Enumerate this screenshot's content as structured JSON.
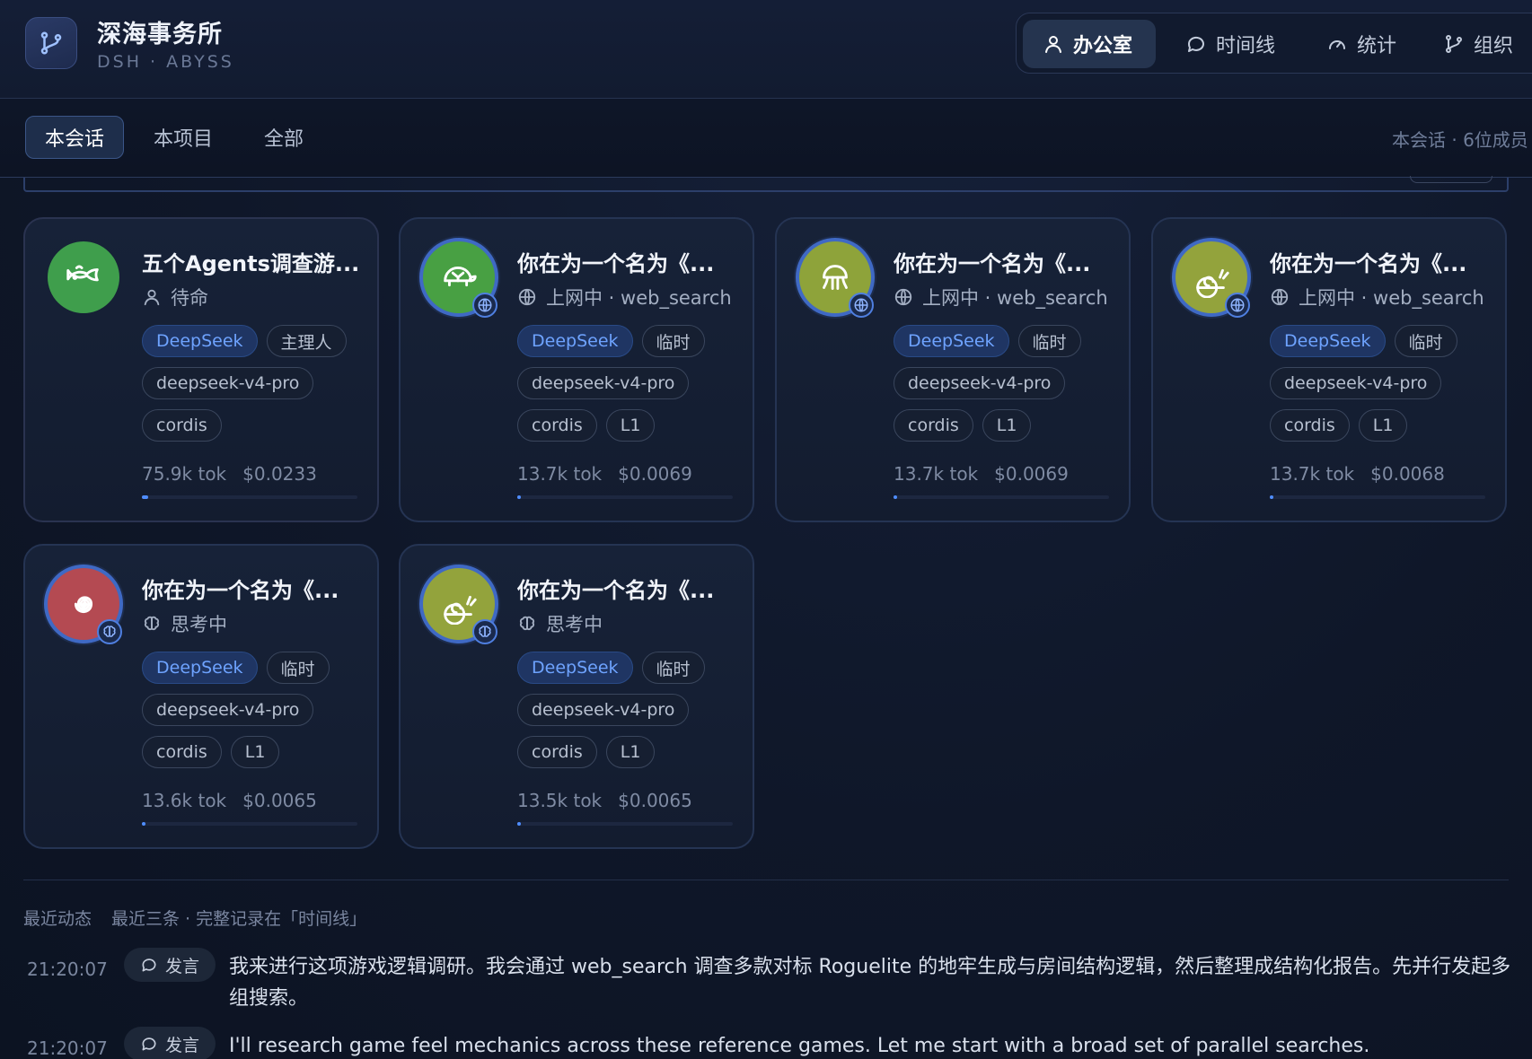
{
  "header": {
    "brand_title": "深海事务所",
    "brand_subtitle": "DSH · ABYSS",
    "logo_icon": "branch-icon",
    "nav": [
      {
        "label": "办公室",
        "icon": "user-icon",
        "active": true
      },
      {
        "label": "时间线",
        "icon": "chat-bubble-icon",
        "active": false
      },
      {
        "label": "统计",
        "icon": "gauge-icon",
        "active": false
      },
      {
        "label": "组织",
        "icon": "branch-icon",
        "active": false
      }
    ]
  },
  "scope": {
    "tabs": [
      {
        "label": "本会话",
        "active": true
      },
      {
        "label": "本项目",
        "active": false
      },
      {
        "label": "全部",
        "active": false
      }
    ],
    "info": "本会话 · 6位成员"
  },
  "agents": [
    {
      "title": "五个Agents调查游...",
      "status": "待命",
      "status_icon": "user-icon",
      "avatar": "fish-icon",
      "avatar_color": "#3f9e4c",
      "badge": "",
      "tags": [
        "DeepSeek",
        "主理人",
        "deepseek-v4-pro",
        "cordis"
      ],
      "tokens": "75.9k tok",
      "cost": "$0.0233",
      "progress": 0.03
    },
    {
      "title": "你在为一个名为《...",
      "status": "上网中 · web_search",
      "status_icon": "globe-icon",
      "avatar": "turtle-icon",
      "avatar_color": "#48a043",
      "badge": "globe-icon",
      "tags": [
        "DeepSeek",
        "临时",
        "deepseek-v4-pro",
        "cordis",
        "L1"
      ],
      "tokens": "13.7k tok",
      "cost": "$0.0069",
      "progress": 0.01
    },
    {
      "title": "你在为一个名为《...",
      "status": "上网中 · web_search",
      "status_icon": "globe-icon",
      "avatar": "jellyfish-icon",
      "avatar_color": "#8ea33a",
      "badge": "globe-icon",
      "tags": [
        "DeepSeek",
        "临时",
        "deepseek-v4-pro",
        "cordis",
        "L1"
      ],
      "tokens": "13.7k tok",
      "cost": "$0.0069",
      "progress": 0.01
    },
    {
      "title": "你在为一个名为《...",
      "status": "上网中 · web_search",
      "status_icon": "globe-icon",
      "avatar": "snail-icon",
      "avatar_color": "#93a33c",
      "badge": "globe-icon",
      "tags": [
        "DeepSeek",
        "临时",
        "deepseek-v4-pro",
        "cordis",
        "L1"
      ],
      "tokens": "13.7k tok",
      "cost": "$0.0068",
      "progress": 0.01
    },
    {
      "title": "你在为一个名为《...",
      "status": "思考中",
      "status_icon": "brain-icon",
      "avatar": "spiral-icon",
      "avatar_color": "#b44a52",
      "badge": "brain-icon",
      "tags": [
        "DeepSeek",
        "临时",
        "deepseek-v4-pro",
        "cordis",
        "L1"
      ],
      "tokens": "13.6k tok",
      "cost": "$0.0065",
      "progress": 0.01
    },
    {
      "title": "你在为一个名为《...",
      "status": "思考中",
      "status_icon": "brain-icon",
      "avatar": "snail-icon",
      "avatar_color": "#93a33c",
      "badge": "brain-icon",
      "tags": [
        "DeepSeek",
        "临时",
        "deepseek-v4-pro",
        "cordis",
        "L1"
      ],
      "tokens": "13.5k tok",
      "cost": "$0.0065",
      "progress": 0.01
    }
  ],
  "activity": {
    "title": "最近动态",
    "hint": "最近三条 · 完整记录在「时间线」",
    "items": [
      {
        "time": "21:20:07",
        "kind": "发言",
        "text": "我来进行这项游戏逻辑调研。我会通过 web_search 调查多款对标 Roguelite 的地牢生成与房间结构逻辑，然后整理成结构化报告。先并行发起多组搜索。"
      },
      {
        "time": "21:20:07",
        "kind": "发言",
        "text": "I'll research game feel mechanics across these reference games. Let me start with a broad set of parallel searches."
      }
    ]
  }
}
